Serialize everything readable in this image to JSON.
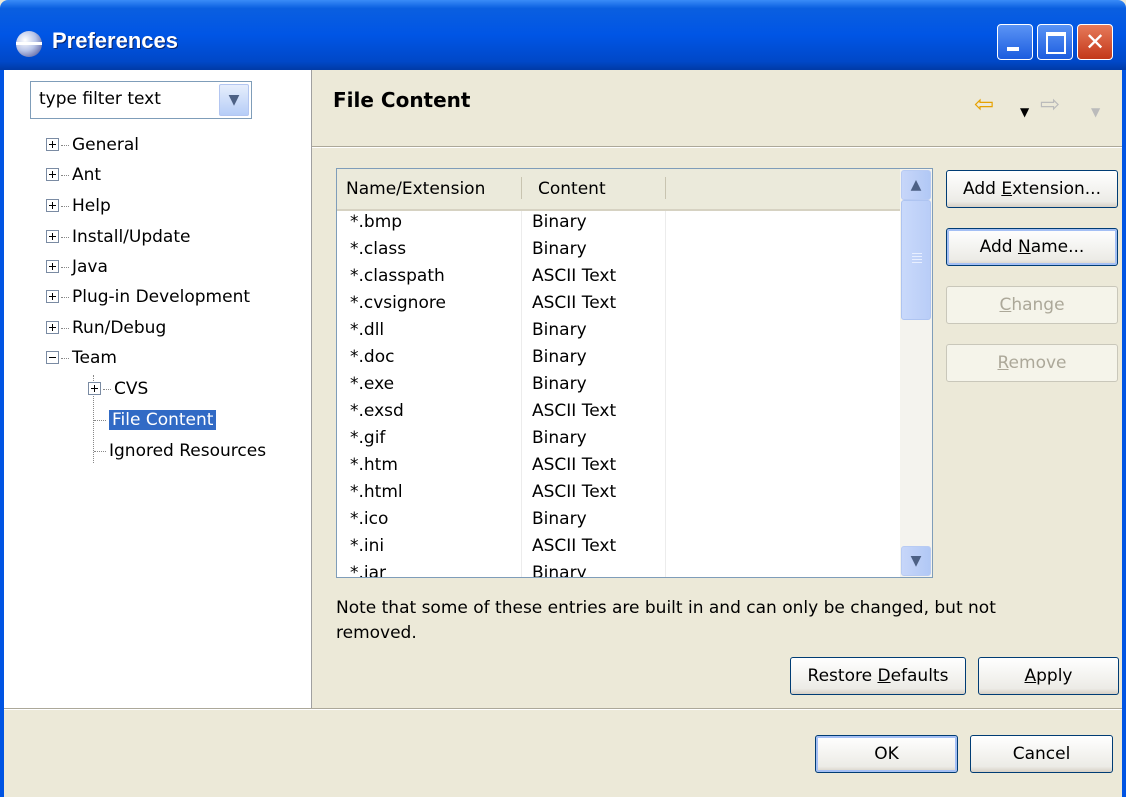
{
  "window": {
    "title": "Preferences"
  },
  "filter": {
    "value": "type filter text"
  },
  "tree": {
    "items": [
      {
        "label": "General"
      },
      {
        "label": "Ant"
      },
      {
        "label": "Help"
      },
      {
        "label": "Install/Update"
      },
      {
        "label": "Java"
      },
      {
        "label": "Plug-in Development"
      },
      {
        "label": "Run/Debug"
      },
      {
        "label": "Team"
      },
      {
        "label": "CVS"
      },
      {
        "label": "File Content",
        "selected": true
      },
      {
        "label": "Ignored Resources"
      }
    ]
  },
  "page": {
    "title": "File Content"
  },
  "table": {
    "columns": [
      "Name/Extension",
      "Content"
    ],
    "rows": [
      [
        "*.bmp",
        "Binary"
      ],
      [
        "*.class",
        "Binary"
      ],
      [
        "*.classpath",
        "ASCII Text"
      ],
      [
        "*.cvsignore",
        "ASCII Text"
      ],
      [
        "*.dll",
        "Binary"
      ],
      [
        "*.doc",
        "Binary"
      ],
      [
        "*.exe",
        "Binary"
      ],
      [
        "*.exsd",
        "ASCII Text"
      ],
      [
        "*.gif",
        "Binary"
      ],
      [
        "*.htm",
        "ASCII Text"
      ],
      [
        "*.html",
        "ASCII Text"
      ],
      [
        "*.ico",
        "Binary"
      ],
      [
        "*.ini",
        "ASCII Text"
      ],
      [
        "*.jar",
        "Binary"
      ]
    ]
  },
  "side_buttons": {
    "add_extension": {
      "pre": "Add ",
      "key": "E",
      "post": "xtension..."
    },
    "add_name": {
      "pre": "Add ",
      "key": "N",
      "post": "ame..."
    },
    "change": {
      "pre": "",
      "key": "C",
      "post": "hange"
    },
    "remove": {
      "pre": "",
      "key": "R",
      "post": "emove"
    }
  },
  "note": "Note that some of these entries are built in and can only be changed, but not removed.",
  "page_buttons": {
    "restore_defaults": {
      "pre": "Restore ",
      "key": "D",
      "post": "efaults"
    },
    "apply": {
      "pre": "",
      "key": "A",
      "post": "pply"
    }
  },
  "dialog_buttons": {
    "ok": "OK",
    "cancel": "Cancel"
  },
  "colors": {
    "titlebar": "#0055e5",
    "selection": "#316ac5",
    "dialog_bg": "#ece9d8",
    "back_arrow": "#e6a100"
  },
  "icons": {
    "window": "eclipse-icon",
    "back": "back-arrow-icon",
    "forward": "forward-arrow-icon"
  }
}
